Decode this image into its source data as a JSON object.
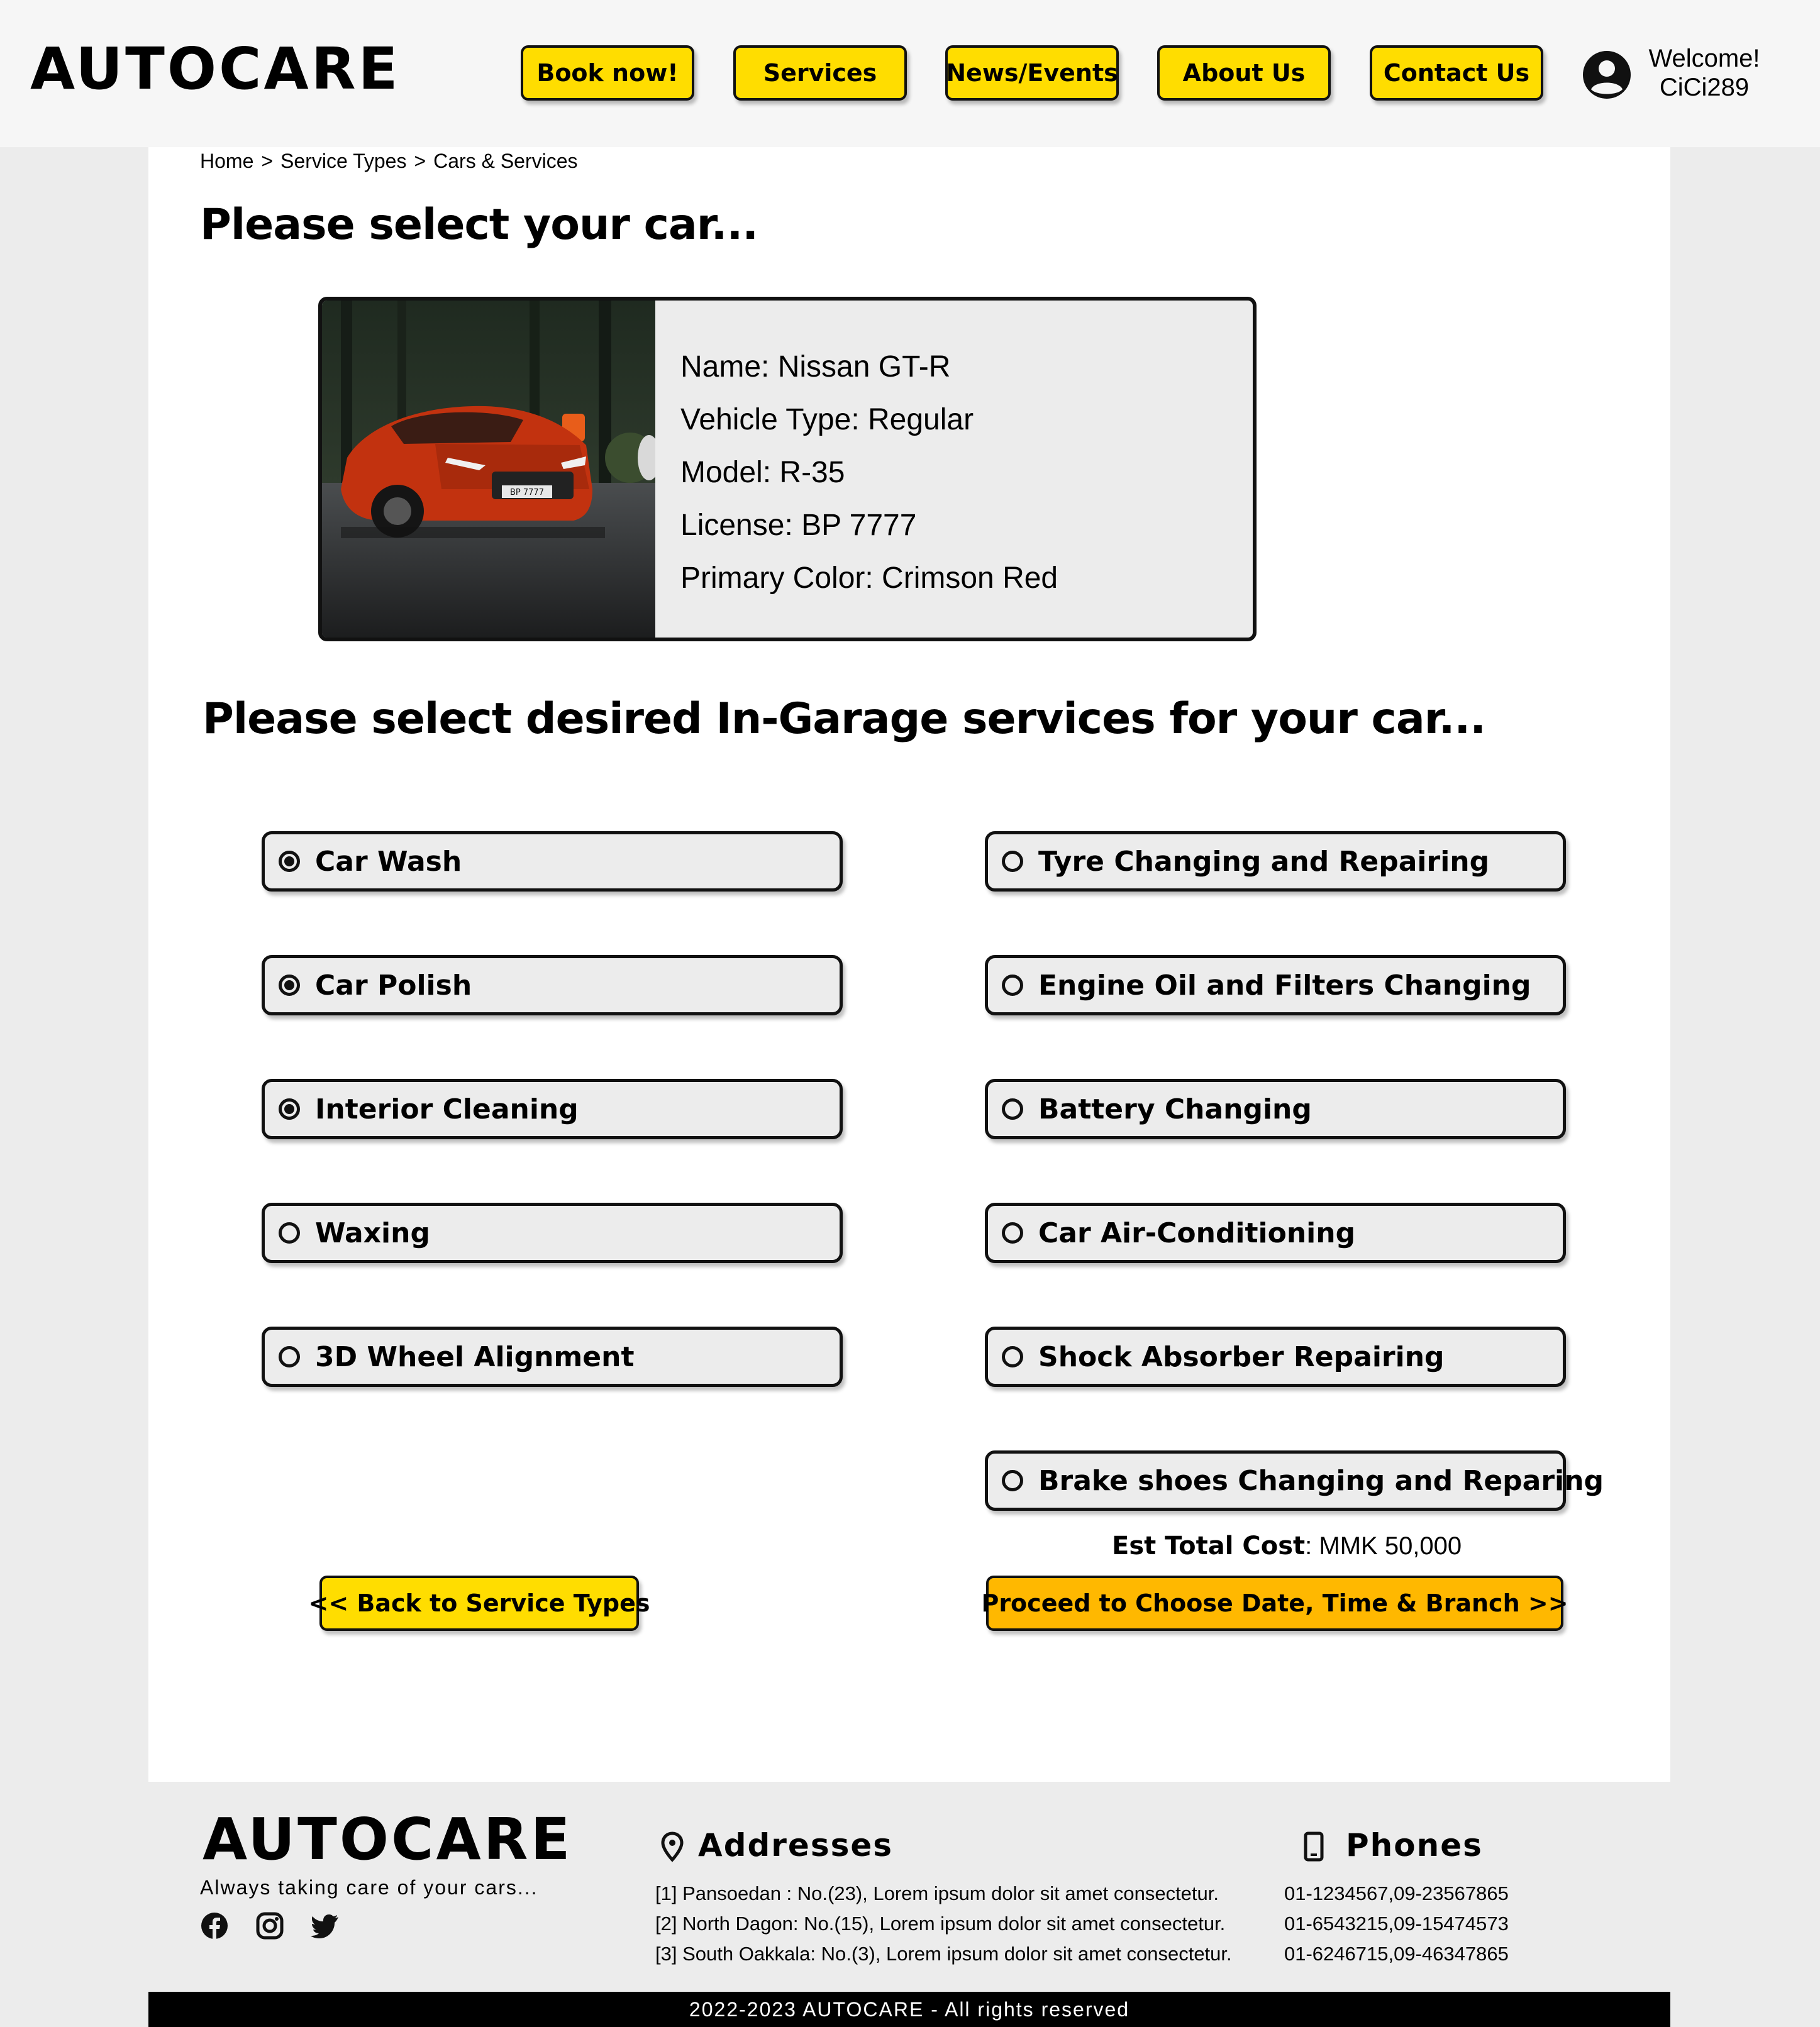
{
  "header": {
    "logo": "AUTOCARE",
    "nav": [
      "Book now!",
      "Services",
      "News/Events",
      "About Us",
      "Contact Us"
    ],
    "welcome": "Welcome!",
    "username": "CiCi289"
  },
  "breadcrumb": [
    "Home",
    ">",
    "Service Types",
    ">",
    "Cars & Services"
  ],
  "car_section": {
    "title": "Please select your car...",
    "car": {
      "name": "Name: Nissan GT-R",
      "vehicle_type": "Vehicle Type: Regular",
      "model": "Model: R-35",
      "license": "License: BP 7777",
      "color": "Primary Color: Crimson Red",
      "plate_text": "BP 7777"
    }
  },
  "services_section": {
    "title": "Please select desired In-Garage services for your car...",
    "left": [
      {
        "label": "Car Wash",
        "selected": true
      },
      {
        "label": "Car Polish",
        "selected": true
      },
      {
        "label": "Interior Cleaning",
        "selected": true
      },
      {
        "label": "Waxing",
        "selected": false
      },
      {
        "label": "3D Wheel Alignment",
        "selected": false
      }
    ],
    "right": [
      {
        "label": "Tyre Changing and Repairing",
        "selected": false
      },
      {
        "label": "Engine Oil and Filters Changing",
        "selected": false
      },
      {
        "label": "Battery Changing",
        "selected": false
      },
      {
        "label": "Car Air-Conditioning",
        "selected": false
      },
      {
        "label": "Shock Absorber Repairing",
        "selected": false
      },
      {
        "label": "Brake shoes Changing and Reparing",
        "selected": false
      }
    ],
    "cost_label": "Est Total Cost",
    "cost_value": ": MMK 50,000",
    "back_button": "<< Back to Service Types",
    "proceed_button": "Proceed to Choose Date, Time & Branch >>"
  },
  "footer": {
    "logo": "AUTOCARE",
    "tagline": "Always taking care of your cars...",
    "addresses_title": "Addresses",
    "addresses": [
      "[1] Pansoedan : No.(23), Lorem ipsum dolor sit amet consectetur.",
      "[2] North Dagon: No.(15), Lorem ipsum dolor sit amet consectetur.",
      "[3] South Oakkala: No.(3), Lorem ipsum dolor sit amet consectetur."
    ],
    "phones_title": "Phones",
    "phones": [
      "01-1234567,09-23567865",
      "01-6543215,09-15474573",
      "01-6246715,09-46347865"
    ],
    "social": [
      "facebook-icon",
      "instagram-icon",
      "twitter-icon"
    ],
    "copyright": "2022-2023 AUTOCARE - All rights reserved"
  },
  "colors": {
    "accent_yellow": "#ffdd00",
    "proceed_orange": "#ffb800",
    "panel_gray": "#ececec",
    "text": "#000000"
  }
}
